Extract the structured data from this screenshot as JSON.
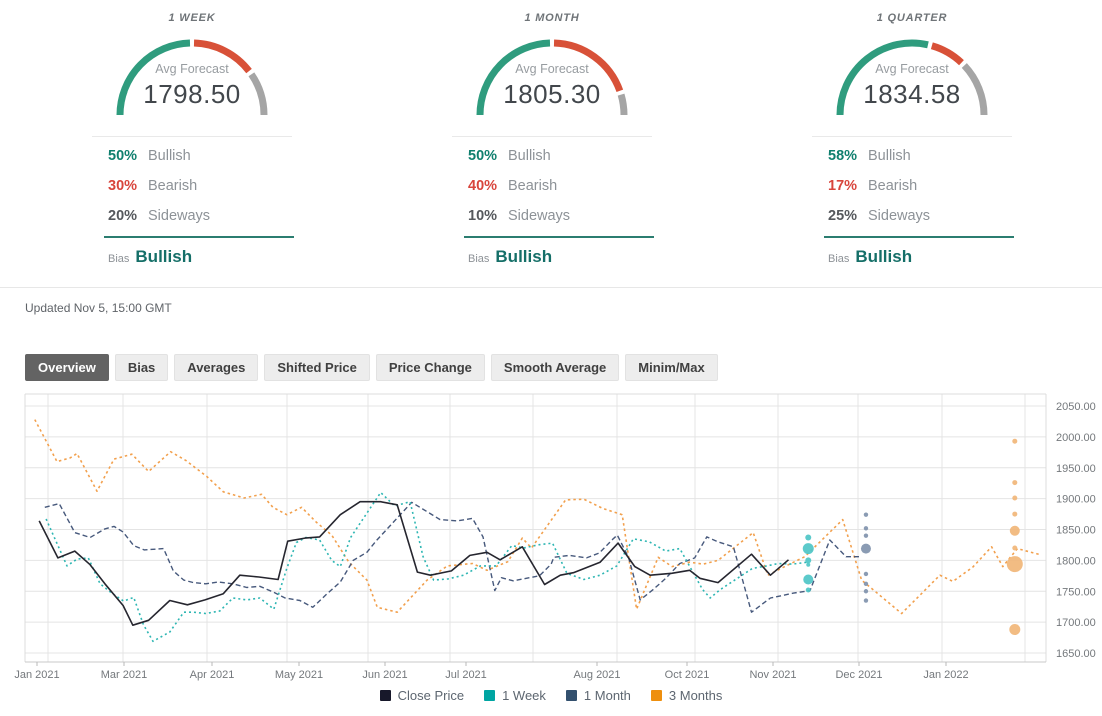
{
  "panels": [
    {
      "title": "1 WEEK",
      "avg_label": "Avg Forecast",
      "avg_value": "1798.50",
      "bullish": 50,
      "bearish": 30,
      "sideways": 20,
      "bullish_pct": "50%",
      "bearish_pct": "30%",
      "sideways_pct": "20%",
      "bullish_label": "Bullish",
      "bearish_label": "Bearish",
      "sideways_label": "Sideways",
      "bias_label": "Bias",
      "bias_value": "Bullish"
    },
    {
      "title": "1 MONTH",
      "avg_label": "Avg Forecast",
      "avg_value": "1805.30",
      "bullish": 50,
      "bearish": 40,
      "sideways": 10,
      "bullish_pct": "50%",
      "bearish_pct": "40%",
      "sideways_pct": "10%",
      "bullish_label": "Bullish",
      "bearish_label": "Bearish",
      "sideways_label": "Sideways",
      "bias_label": "Bias",
      "bias_value": "Bullish"
    },
    {
      "title": "1 QUARTER",
      "avg_label": "Avg Forecast",
      "avg_value": "1834.58",
      "bullish": 58,
      "bearish": 17,
      "sideways": 25,
      "bullish_pct": "58%",
      "bearish_pct": "17%",
      "sideways_pct": "25%",
      "bullish_label": "Bullish",
      "bearish_label": "Bearish",
      "sideways_label": "Sideways",
      "bias_label": "Bias",
      "bias_value": "Bullish"
    }
  ],
  "updated": "Updated Nov 5, 15:00 GMT",
  "tabs": [
    {
      "label": "Overview",
      "active": true
    },
    {
      "label": "Bias",
      "active": false
    },
    {
      "label": "Averages",
      "active": false
    },
    {
      "label": "Shifted Price",
      "active": false
    },
    {
      "label": "Price Change",
      "active": false
    },
    {
      "label": "Smooth Average",
      "active": false
    },
    {
      "label": "Minim/Max",
      "active": false
    }
  ],
  "legend": [
    {
      "label": "Close Price",
      "color": "#17182a"
    },
    {
      "label": "1 Week",
      "color": "#00a5a2"
    },
    {
      "label": "1 Month",
      "color": "#33506e"
    },
    {
      "label": "3 Months",
      "color": "#ee8f0e"
    }
  ],
  "colors": {
    "gauge_green": "#2f9c7e",
    "gauge_red": "#d85138",
    "gauge_gray": "#a5a5a5",
    "teal_dark": "#0f7f6e",
    "red_text": "#d8453c",
    "gray_text": "#55585c",
    "label_gray": "#8d9297",
    "bias_teal": "#156f68",
    "underline": "#2b7d70"
  },
  "chart_data": {
    "type": "line",
    "title": "",
    "xlabel": "",
    "ylabel": "",
    "x_unit": "months since Jan 2021",
    "ylim": [
      1650,
      2050
    ],
    "y_tick_step": 50,
    "grid": true,
    "legend_position": "bottom",
    "x_ticks": [
      {
        "label": "Jan 2021",
        "m": 0
      },
      {
        "label": "Mar 2021",
        "m": 2
      },
      {
        "label": "Apr 2021",
        "m": 3
      },
      {
        "label": "May 2021",
        "m": 4
      },
      {
        "label": "Jun 2021",
        "m": 5
      },
      {
        "label": "Jul 2021",
        "m": 6
      },
      {
        "label": "Aug 2021",
        "m": 7
      },
      {
        "label": "Oct 2021",
        "m": 9
      },
      {
        "label": "Nov 2021",
        "m": 10
      },
      {
        "label": "Dec 2021",
        "m": 11
      },
      {
        "label": "Jan 2022",
        "m": 12
      }
    ],
    "series": [
      {
        "name": "Close Price",
        "style": "solid",
        "color": "#26262f",
        "width": 1.6,
        "points": [
          [
            0.05,
            1864
          ],
          [
            0.48,
            1804
          ],
          [
            0.87,
            1815
          ],
          [
            1.22,
            1793
          ],
          [
            1.56,
            1762
          ],
          [
            1.98,
            1727
          ],
          [
            2.1,
            1695
          ],
          [
            2.28,
            1703
          ],
          [
            2.52,
            1735
          ],
          [
            2.72,
            1728
          ],
          [
            2.92,
            1736
          ],
          [
            3.13,
            1746
          ],
          [
            3.32,
            1776
          ],
          [
            3.54,
            1773
          ],
          [
            3.76,
            1769
          ],
          [
            3.87,
            1831
          ],
          [
            4.07,
            1836
          ],
          [
            4.24,
            1838
          ],
          [
            4.48,
            1874
          ],
          [
            4.71,
            1895
          ],
          [
            4.95,
            1895
          ],
          [
            5.15,
            1890
          ],
          [
            5.4,
            1781
          ],
          [
            5.56,
            1776
          ],
          [
            5.82,
            1783
          ],
          [
            6.03,
            1808
          ],
          [
            6.16,
            1813
          ],
          [
            6.26,
            1801
          ],
          [
            6.43,
            1822
          ],
          [
            6.6,
            1761
          ],
          [
            6.72,
            1776
          ],
          [
            6.82,
            1780
          ],
          [
            7.07,
            1797
          ],
          [
            7.47,
            1828
          ],
          [
            7.84,
            1790
          ],
          [
            8.18,
            1776
          ],
          [
            8.66,
            1779
          ],
          [
            9.03,
            1784
          ],
          [
            9.15,
            1771
          ],
          [
            9.36,
            1764
          ],
          [
            9.75,
            1810
          ],
          [
            9.97,
            1776
          ],
          [
            10.18,
            1801
          ]
        ]
      },
      {
        "name": "1 Week",
        "style": "dotted",
        "color": "#2eb6b3",
        "width": 1.6,
        "points": [
          [
            0.21,
            1867
          ],
          [
            0.69,
            1791
          ],
          [
            0.92,
            1802
          ],
          [
            1.18,
            1804
          ],
          [
            1.45,
            1762
          ],
          [
            1.72,
            1747
          ],
          [
            1.99,
            1734
          ],
          [
            2.11,
            1740
          ],
          [
            2.22,
            1696
          ],
          [
            2.33,
            1669
          ],
          [
            2.52,
            1684
          ],
          [
            2.68,
            1716
          ],
          [
            2.79,
            1716
          ],
          [
            2.93,
            1714
          ],
          [
            3.09,
            1718
          ],
          [
            3.24,
            1739
          ],
          [
            3.4,
            1736
          ],
          [
            3.55,
            1739
          ],
          [
            3.71,
            1721
          ],
          [
            3.86,
            1787
          ],
          [
            3.97,
            1829
          ],
          [
            4.08,
            1837
          ],
          [
            4.24,
            1833
          ],
          [
            4.38,
            1800
          ],
          [
            4.48,
            1790
          ],
          [
            4.6,
            1837
          ],
          [
            4.95,
            1910
          ],
          [
            5.12,
            1888
          ],
          [
            5.31,
            1895
          ],
          [
            5.47,
            1806
          ],
          [
            5.6,
            1768
          ],
          [
            5.78,
            1770
          ],
          [
            5.97,
            1776
          ],
          [
            6.11,
            1791
          ],
          [
            6.23,
            1791
          ],
          [
            6.35,
            1824
          ],
          [
            6.44,
            1820
          ],
          [
            6.55,
            1825
          ],
          [
            6.66,
            1828
          ],
          [
            6.77,
            1779
          ],
          [
            6.9,
            1769
          ],
          [
            7.07,
            1776
          ],
          [
            7.44,
            1791
          ],
          [
            7.81,
            1835
          ],
          [
            8.16,
            1830
          ],
          [
            8.53,
            1815
          ],
          [
            8.84,
            1819
          ],
          [
            9.18,
            1753
          ],
          [
            9.27,
            1739
          ],
          [
            9.38,
            1752
          ],
          [
            9.76,
            1787
          ],
          [
            9.93,
            1791
          ],
          [
            10.06,
            1795
          ],
          [
            10.23,
            1794
          ],
          [
            10.4,
            1797
          ]
        ]
      },
      {
        "name": "1 Month",
        "style": "dashed",
        "color": "#47597c",
        "width": 1.4,
        "points": [
          [
            0.18,
            1886
          ],
          [
            0.51,
            1892
          ],
          [
            0.87,
            1845
          ],
          [
            1.22,
            1837
          ],
          [
            1.56,
            1851
          ],
          [
            1.77,
            1855
          ],
          [
            1.98,
            1846
          ],
          [
            2.11,
            1824
          ],
          [
            2.23,
            1817
          ],
          [
            2.33,
            1818
          ],
          [
            2.45,
            1819
          ],
          [
            2.56,
            1783
          ],
          [
            2.68,
            1768
          ],
          [
            2.79,
            1764
          ],
          [
            2.93,
            1762
          ],
          [
            3.07,
            1765
          ],
          [
            3.24,
            1762
          ],
          [
            3.4,
            1756
          ],
          [
            3.55,
            1758
          ],
          [
            3.7,
            1749
          ],
          [
            3.84,
            1739
          ],
          [
            4.01,
            1735
          ],
          [
            4.16,
            1724
          ],
          [
            4.32,
            1745
          ],
          [
            4.48,
            1765
          ],
          [
            4.63,
            1800
          ],
          [
            4.79,
            1813
          ],
          [
            4.9,
            1832
          ],
          [
            5.33,
            1894
          ],
          [
            5.68,
            1866
          ],
          [
            5.89,
            1864
          ],
          [
            6.05,
            1868
          ],
          [
            6.13,
            1838
          ],
          [
            6.22,
            1751
          ],
          [
            6.27,
            1772
          ],
          [
            6.36,
            1767
          ],
          [
            6.46,
            1771
          ],
          [
            6.56,
            1775
          ],
          [
            6.65,
            1794
          ],
          [
            6.67,
            1805
          ],
          [
            6.79,
            1808
          ],
          [
            6.92,
            1804
          ],
          [
            7.05,
            1812
          ],
          [
            7.36,
            1835
          ],
          [
            7.45,
            1841
          ],
          [
            7.7,
            1805
          ],
          [
            7.96,
            1736
          ],
          [
            8.25,
            1753
          ],
          [
            8.53,
            1771
          ],
          [
            8.84,
            1795
          ],
          [
            9.09,
            1804
          ],
          [
            9.23,
            1838
          ],
          [
            9.36,
            1830
          ],
          [
            9.54,
            1822
          ],
          [
            9.75,
            1716
          ],
          [
            9.97,
            1739
          ],
          [
            10.24,
            1747
          ],
          [
            10.43,
            1751
          ],
          [
            10.66,
            1833
          ],
          [
            10.85,
            1806
          ],
          [
            11.0,
            1806
          ]
        ]
      },
      {
        "name": "3 Months",
        "style": "dashed",
        "color": "#f2a04d",
        "width": 1.6,
        "points": [
          [
            -0.05,
            2028
          ],
          [
            0.46,
            1960
          ],
          [
            0.76,
            1966
          ],
          [
            0.92,
            1973
          ],
          [
            1.38,
            1912
          ],
          [
            1.77,
            1964
          ],
          [
            2.09,
            1972
          ],
          [
            2.28,
            1944
          ],
          [
            2.53,
            1976
          ],
          [
            2.7,
            1962
          ],
          [
            2.94,
            1936
          ],
          [
            3.13,
            1911
          ],
          [
            3.37,
            1901
          ],
          [
            3.57,
            1907
          ],
          [
            3.7,
            1886
          ],
          [
            3.86,
            1874
          ],
          [
            4.03,
            1886
          ],
          [
            4.2,
            1862
          ],
          [
            4.38,
            1841
          ],
          [
            4.58,
            1797
          ],
          [
            4.79,
            1768
          ],
          [
            4.91,
            1724
          ],
          [
            5.15,
            1716
          ],
          [
            5.52,
            1768
          ],
          [
            5.77,
            1791
          ],
          [
            6.05,
            1795
          ],
          [
            6.16,
            1784
          ],
          [
            6.32,
            1798
          ],
          [
            6.43,
            1836
          ],
          [
            6.5,
            1820
          ],
          [
            6.76,
            1898
          ],
          [
            6.9,
            1899
          ],
          [
            7.13,
            1884
          ],
          [
            7.56,
            1874
          ],
          [
            7.88,
            1721
          ],
          [
            8.36,
            1805
          ],
          [
            8.67,
            1790
          ],
          [
            9.03,
            1797
          ],
          [
            9.19,
            1794
          ],
          [
            9.36,
            1800
          ],
          [
            9.77,
            1845
          ],
          [
            9.94,
            1776
          ],
          [
            10.18,
            1793
          ],
          [
            10.37,
            1806
          ],
          [
            10.81,
            1866
          ],
          [
            11.03,
            1768
          ],
          [
            11.49,
            1714
          ],
          [
            11.93,
            1776
          ],
          [
            12.08,
            1766
          ],
          [
            12.31,
            1789
          ],
          [
            12.53,
            1822
          ],
          [
            12.66,
            1790
          ],
          [
            12.83,
            1819
          ],
          [
            13.1,
            1809
          ]
        ]
      }
    ],
    "forecast_dots": [
      {
        "name": "1 Week",
        "color": "#4ec5c7",
        "m": 10.41,
        "points": [
          [
            1837,
            3
          ],
          [
            1819,
            5.5
          ],
          [
            1800,
            3
          ],
          [
            1793,
            2
          ],
          [
            1769,
            5
          ],
          [
            1752,
            2.5
          ]
        ]
      },
      {
        "name": "1 Month",
        "color": "#8092ad",
        "m": 11.08,
        "points": [
          [
            1874,
            2.2
          ],
          [
            1852,
            2.2
          ],
          [
            1840,
            2.2
          ],
          [
            1819,
            5
          ],
          [
            1778,
            2.2
          ],
          [
            1762,
            2.2
          ],
          [
            1750,
            2.2
          ],
          [
            1735,
            2.2
          ]
        ]
      },
      {
        "name": "3 Months",
        "color": "#f1b678",
        "m": 12.8,
        "points": [
          [
            1993,
            2.5
          ],
          [
            1926,
            2.5
          ],
          [
            1901,
            2.5
          ],
          [
            1875,
            2.5
          ],
          [
            1848,
            5
          ],
          [
            1820,
            2.5
          ],
          [
            1794,
            8
          ],
          [
            1688,
            5.5
          ]
        ]
      }
    ]
  }
}
